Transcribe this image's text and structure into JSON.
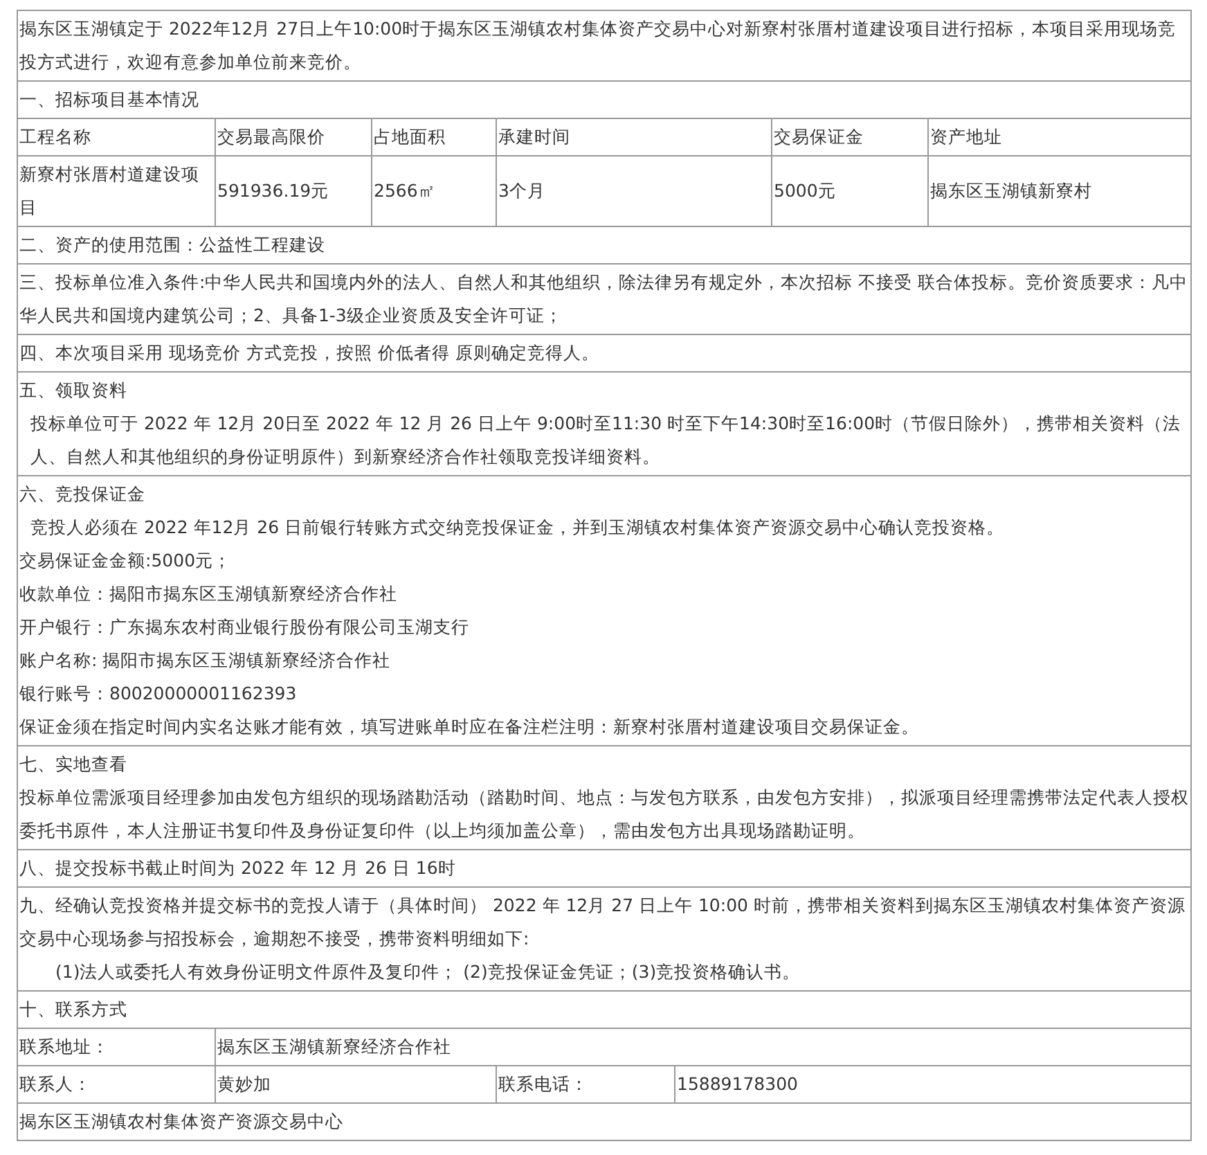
{
  "intro": "揭东区玉湖镇定于 2022年12月 27日上午10:00时于揭东区玉湖镇农村集体资产交易中心对新寮村张厝村道建设项目进行招标，本项目采用现场竞投方式进行，欢迎有意参加单位前来竞价。",
  "basic_info": {
    "heading": "一、招标项目基本情况",
    "columns": [
      "工程名称",
      "交易最高限价",
      "占地面积",
      "承建时间",
      "交易保证金",
      "资产地址"
    ],
    "row": [
      "新寮村张厝村道建设项目",
      "591936.19元",
      "2566㎡",
      "3个月",
      "5000元",
      "揭东区玉湖镇新寮村"
    ]
  },
  "scope": "二、资产的使用范围：公益性工程建设",
  "eligibility": "三、投标单位准入条件:中华人民共和国境内外的法人、自然人和其他组织，除法律另有规定外，本次招标 不接受 联合体投标。竞价资质要求：凡中华人民共和国境内建筑公司；2、具备1-3级企业资质及安全许可证；",
  "method": "四、本次项目采用 现场竞价 方式竞投，按照 价低者得 原则确定竞得人。",
  "materials": {
    "heading": "五、领取资料",
    "lines": [
      {
        "kind": "indent",
        "text": "投标单位可于  2022 年 12月 20日至 2022 年 12 月 26 日上午 9:00时至11:30 时至下午14:30时至16:00时（节假日除外），携带相关资料（法人、自然人和其他组织的身份证明原件）到新寮经济合作社领取竞投详细资料。"
      }
    ]
  },
  "deposit": {
    "heading": "六、竞投保证金",
    "lines": [
      {
        "kind": "indent",
        "text": "竞投人必须在 2022 年12月 26 日前银行转账方式交纳竞投保证金，并到玉湖镇农村集体资产资源交易中心确认竞投资格。"
      },
      {
        "kind": "plain",
        "text": "交易保证金金额:5000元；"
      },
      {
        "kind": "plain",
        "text": "收款单位：揭阳市揭东区玉湖镇新寮经济合作社"
      },
      {
        "kind": "plain",
        "text": "开户银行：广东揭东农村商业银行股份有限公司玉湖支行"
      },
      {
        "kind": "plain",
        "text": "账户名称: 揭阳市揭东区玉湖镇新寮经济合作社"
      },
      {
        "kind": "plain",
        "text": "银行账号：80020000001162393"
      },
      {
        "kind": "plain",
        "text": "保证金须在指定时间内实名达账才能有效，填写进账单时应在备注栏注明：新寮村张厝村道建设项目交易保证金。"
      }
    ]
  },
  "site_visit": {
    "heading": "七、实地查看",
    "lines": [
      {
        "kind": "plain",
        "text": "投标单位需派项目经理参加由发包方组织的现场踏勘活动（踏勘时间、地点：与发包方联系，由发包方安排），拟派项目经理需携带法定代表人授权委托书原件，本人注册证书复印件及身份证复印件（以上均须加盖公章），需由发包方出具现场踏勘证明。"
      }
    ]
  },
  "deadline": "八、提交投标书截止时间为 2022 年  12 月 26 日 16时",
  "meeting": {
    "lines": [
      {
        "kind": "plain",
        "text": "九、经确认竞投资格并提交标书的竞投人请于（具体时间） 2022  年 12月  27 日上午  10:00  时前，携带相关资料到揭东区玉湖镇农村集体资产资源交易中心现场参与招投标会，逾期恕不接受，携带资料明细如下:"
      },
      {
        "kind": "item",
        "text": "(1)法人或委托人有效身份证明文件原件及复印件； (2)竞投保证金凭证；(3)竞投资格确认书。"
      }
    ]
  },
  "contact": {
    "heading": "十、联系方式",
    "address_label": "联系地址：",
    "address": "揭东区玉湖镇新寮经济合作社",
    "person_label": "联系人：",
    "person": "黄妙加",
    "phone_label": "联系电话：",
    "phone": "15889178300"
  },
  "footer": "揭东区玉湖镇农村集体资产资源交易中心"
}
